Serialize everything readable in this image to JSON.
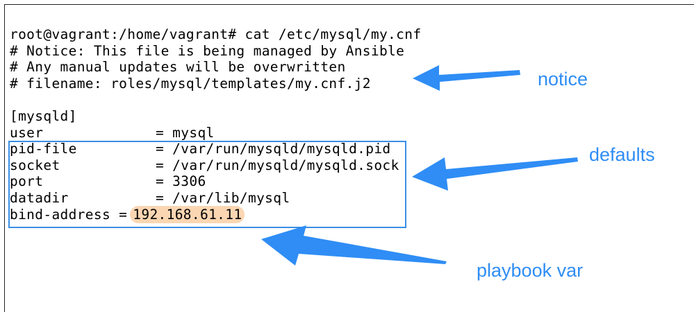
{
  "terminal": {
    "prompt_line": "root@vagrant:/home/vagrant# cat /etc/mysql/my.cnf",
    "comments": [
      "# Notice: This file is being managed by Ansible",
      "# Any manual updates will be overwritten",
      "# filename: roles/mysql/templates/my.cnf.j2"
    ],
    "section": "[mysqld]",
    "settings": [
      {
        "key": "user",
        "value": "= mysql"
      },
      {
        "key": "pid-file",
        "value": "= /var/run/mysqld/mysqld.pid"
      },
      {
        "key": "socket",
        "value": "= /var/run/mysqld/mysqld.sock"
      },
      {
        "key": "port",
        "value": "= 3306"
      },
      {
        "key": "datadir",
        "value": "= /var/lib/mysql"
      }
    ],
    "bind_address": {
      "key": "bind-address =",
      "value": "192.168.61.11"
    }
  },
  "annotations": {
    "notice": "notice",
    "defaults": "defaults",
    "playbook_var": "playbook var"
  },
  "colors": {
    "annotation": "#2f8df5",
    "box_border": "#3a8ee6",
    "highlight": "#fbd6b2"
  }
}
